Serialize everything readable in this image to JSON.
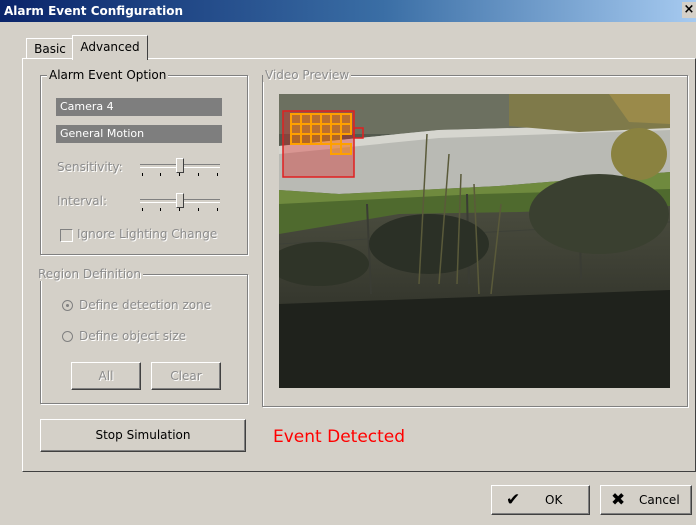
{
  "window": {
    "title": "Alarm Event Configuration",
    "close_glyph": "×"
  },
  "tabs": [
    {
      "label": "Basic",
      "active": false
    },
    {
      "label": "Advanced",
      "active": true
    }
  ],
  "alarm_event_option": {
    "legend": "Alarm Event Option",
    "camera": "Camera 4",
    "event_type": "General Motion",
    "sensitivity_label": "Sensitivity:",
    "interval_label": "Interval:",
    "sensitivity_level": 0.5,
    "interval_level": 0.5,
    "ignore_lighting_label": "Ignore Lighting Change",
    "ignore_lighting_checked": false
  },
  "region_definition": {
    "legend": "Region Definition",
    "detection_zone_label": "Define detection zone",
    "object_size_label": "Define object size",
    "selected": "detection_zone",
    "all_label": "All",
    "clear_label": "Clear"
  },
  "video_preview": {
    "legend": "Video Preview"
  },
  "actions": {
    "stop_simulation": "Stop Simulation",
    "event_status": "Event Detected",
    "ok_label": "OK",
    "cancel_label": "Cancel"
  },
  "colors": {
    "event_text": "#ff0000",
    "zone_border": "#e02020",
    "grid_cells": "#ffa000",
    "title_bar_start": "#0a246a"
  },
  "icons": {
    "ok": "checkmark-icon",
    "cancel": "x-icon",
    "close": "close-icon"
  }
}
